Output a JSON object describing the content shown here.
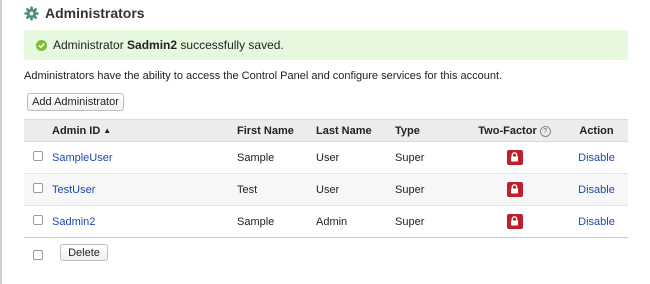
{
  "page": {
    "title": "Administrators"
  },
  "alert": {
    "prefix": "Administrator",
    "name": "Sadmin2",
    "suffix": "successfully saved."
  },
  "description": "Administrators have the ability to access the Control Panel and configure services for this account.",
  "buttons": {
    "add": "Add Administrator",
    "delete": "Delete"
  },
  "table": {
    "headers": {
      "admin_id": "Admin ID",
      "sort_indicator": "▲",
      "first_name": "First Name",
      "last_name": "Last Name",
      "type": "Type",
      "two_factor": "Two-Factor",
      "two_factor_help": "?",
      "action": "Action"
    },
    "rows": [
      {
        "admin_id": "SampleUser",
        "first_name": "Sample",
        "last_name": "User",
        "type": "Super",
        "action": "Disable"
      },
      {
        "admin_id": "TestUser",
        "first_name": "Test",
        "last_name": "User",
        "type": "Super",
        "action": "Disable"
      },
      {
        "admin_id": "Sadmin2",
        "first_name": "Sample",
        "last_name": "Admin",
        "type": "Super",
        "action": "Disable"
      }
    ]
  },
  "icons": {
    "header": "gear-icon",
    "alert": "success-check-icon",
    "two_factor": "lock-icon"
  },
  "colors": {
    "alert_bg": "#e6f9df",
    "alert_icon": "#7dbf2c",
    "link": "#1f4aa8",
    "lock_bg": "#c0202e",
    "gear": "#4f8f7f"
  }
}
